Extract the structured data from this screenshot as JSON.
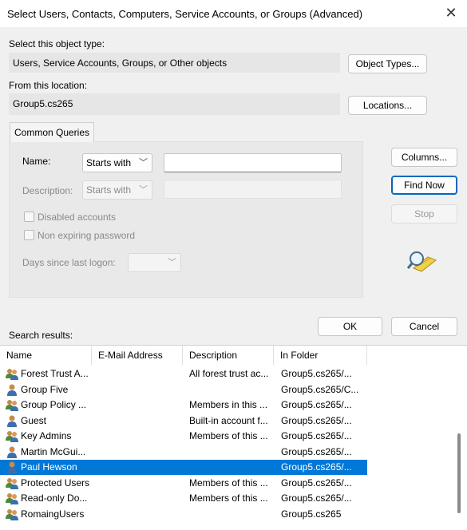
{
  "window": {
    "title": "Select Users, Contacts, Computers, Service Accounts, or Groups (Advanced)",
    "close_glyph": "✕"
  },
  "object_type": {
    "label": "Select this object type:",
    "value": "Users, Service Accounts, Groups, or Other objects",
    "button": "Object Types..."
  },
  "location": {
    "label": "From this location:",
    "value": "Group5.cs265",
    "button": "Locations..."
  },
  "common_queries": {
    "tab": "Common Queries",
    "name_label": "Name:",
    "name_mode": "Starts with",
    "name_value": "",
    "description_label": "Description:",
    "description_mode": "Starts with",
    "disabled_accounts": "Disabled accounts",
    "non_expiring": "Non expiring password",
    "days_label": "Days since last logon:"
  },
  "side_buttons": {
    "columns": "Columns...",
    "find_now": "Find Now",
    "stop": "Stop"
  },
  "footer": {
    "ok": "OK",
    "cancel": "Cancel"
  },
  "results": {
    "label": "Search results:",
    "columns": [
      "Name",
      "E-Mail Address",
      "Description",
      "In Folder"
    ],
    "rows": [
      {
        "name": "Forest Trust A...",
        "email": "",
        "description": "All forest trust ac...",
        "folder": "Group5.cs265/...",
        "icon": "group-icon"
      },
      {
        "name": "Group Five",
        "email": "",
        "description": "",
        "folder": "Group5.cs265/C...",
        "icon": "user-icon"
      },
      {
        "name": "Group Policy ...",
        "email": "",
        "description": "Members in this ...",
        "folder": "Group5.cs265/...",
        "icon": "group-icon"
      },
      {
        "name": "Guest",
        "email": "",
        "description": "Built-in account f...",
        "folder": "Group5.cs265/...",
        "icon": "user-icon"
      },
      {
        "name": "Key Admins",
        "email": "",
        "description": "Members of this ...",
        "folder": "Group5.cs265/...",
        "icon": "group-icon"
      },
      {
        "name": "Martin McGui...",
        "email": "",
        "description": "",
        "folder": "Group5.cs265/...",
        "icon": "user-icon"
      },
      {
        "name": "Paul Hewson",
        "email": "",
        "description": "",
        "folder": "Group5.cs265/...",
        "icon": "user-icon",
        "selected": true
      },
      {
        "name": "Protected Users",
        "email": "",
        "description": "Members of this ...",
        "folder": "Group5.cs265/...",
        "icon": "group-icon"
      },
      {
        "name": "Read-only Do...",
        "email": "",
        "description": "Members of this ...",
        "folder": "Group5.cs265/...",
        "icon": "group-icon"
      },
      {
        "name": "RomaingUsers",
        "email": "",
        "description": "",
        "folder": "Group5.cs265",
        "icon": "group-icon"
      }
    ]
  },
  "colors": {
    "selection": "#0078d7",
    "accent_border": "#0067c0"
  }
}
